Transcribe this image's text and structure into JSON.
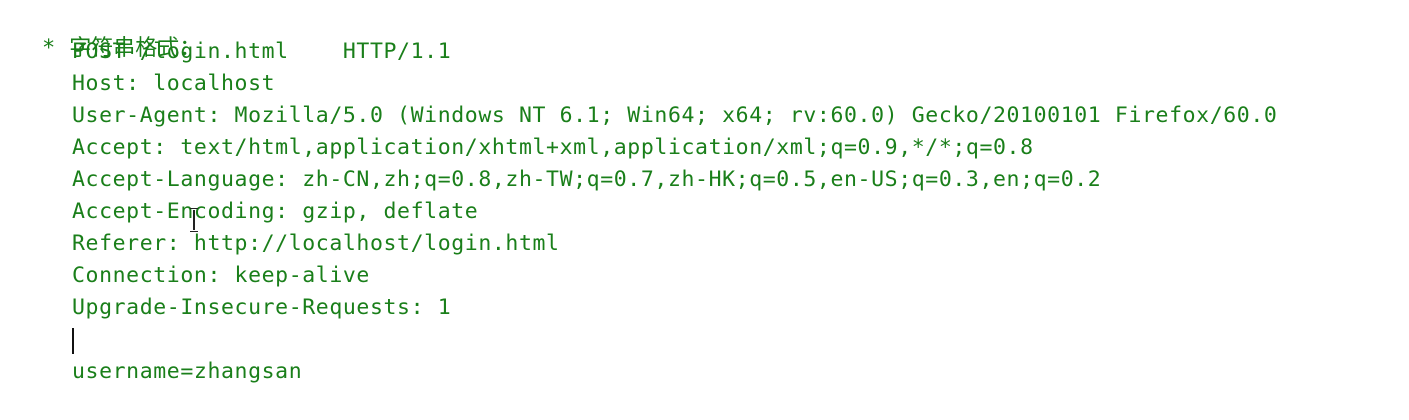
{
  "heading": {
    "bullet": "*",
    "text": "字符串格式："
  },
  "request": {
    "lines": [
      "POST /login.html    HTTP/1.1",
      "Host: localhost",
      "User-Agent: Mozilla/5.0 (Windows NT 6.1; Win64; x64; rv:60.0) Gecko/20100101 Firefox/60.0",
      "Accept: text/html,application/xhtml+xml,application/xml;q=0.9,*/*;q=0.8",
      "Accept-Language: zh-CN,zh;q=0.8,zh-TW;q=0.7,zh-HK;q=0.5,en-US;q=0.3,en;q=0.2",
      "Accept-Encoding: gzip, deflate",
      "Referer: http://localhost/login.html",
      "Connection: keep-alive",
      "Upgrade-Insecure-Requests: 1",
      "",
      "username=zhangsan"
    ]
  },
  "colors": {
    "text": "#1a7f1a",
    "background": "#ffffff",
    "caret": "#111111"
  }
}
